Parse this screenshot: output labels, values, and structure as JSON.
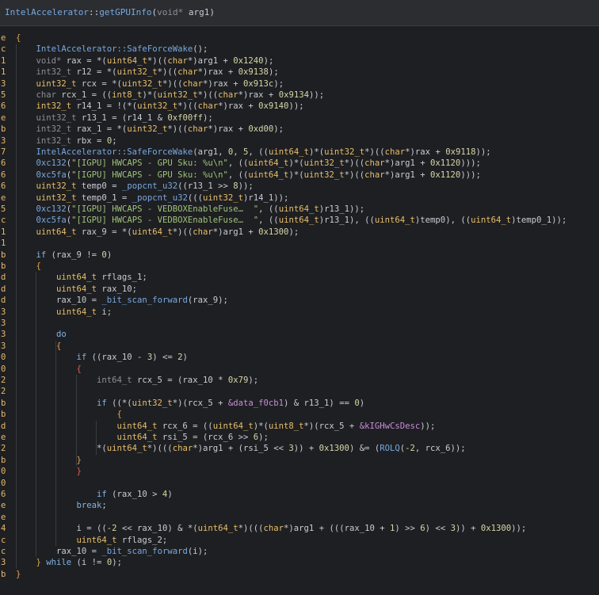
{
  "header": {
    "class_name": "IntelAccelerator",
    "sep": "::",
    "func_name": "getGPUInfo",
    "open": "(",
    "param_type": "void*",
    "param_name": " arg1",
    "close": ")"
  },
  "theme": {
    "background": "#1e1f22",
    "type": "#e8bf6a",
    "keyword": "#7fb4e6",
    "function": "#79a8e0",
    "number": "#d7d7a8",
    "string": "#9ec27a"
  },
  "lines": [
    {
      "g": "e",
      "tokens": [
        [
          "brace",
          "{"
        ]
      ]
    },
    {
      "g": "c",
      "tokens": [
        [
          "fn",
          "IntelAccelerator::SafeForceWake"
        ],
        [
          "pun",
          "();"
        ]
      ]
    },
    {
      "g": "1",
      "tokens": [
        [
          "dim",
          "void* "
        ],
        [
          "plain",
          "rax = *("
        ],
        [
          "type",
          "uint64_t"
        ],
        [
          "plain",
          "*)(("
        ],
        [
          "type",
          "char"
        ],
        [
          "plain",
          "*)arg1 + "
        ],
        [
          "num",
          "0x1240"
        ],
        [
          "plain",
          ");"
        ]
      ]
    },
    {
      "g": "1",
      "tokens": [
        [
          "dim",
          "int32_t "
        ],
        [
          "plain",
          "r12 = *("
        ],
        [
          "type",
          "uint32_t"
        ],
        [
          "plain",
          "*)(("
        ],
        [
          "type",
          "char"
        ],
        [
          "plain",
          "*)rax + "
        ],
        [
          "num",
          "0x9138"
        ],
        [
          "plain",
          ");"
        ]
      ]
    },
    {
      "g": "3",
      "tokens": [
        [
          "type",
          "uint32_t "
        ],
        [
          "plain",
          "rcx = *("
        ],
        [
          "type",
          "uint32_t"
        ],
        [
          "plain",
          "*)(("
        ],
        [
          "type",
          "char"
        ],
        [
          "plain",
          "*)rax + "
        ],
        [
          "num",
          "0x913c"
        ],
        [
          "plain",
          ");"
        ]
      ]
    },
    {
      "g": "5",
      "tokens": [
        [
          "dim",
          "char "
        ],
        [
          "plain",
          "rcx_1 = (("
        ],
        [
          "type",
          "int8_t"
        ],
        [
          "plain",
          ")*("
        ],
        [
          "type",
          "uint32_t"
        ],
        [
          "plain",
          "*)(("
        ],
        [
          "type",
          "char"
        ],
        [
          "plain",
          "*)rax + "
        ],
        [
          "num",
          "0x9134"
        ],
        [
          "plain",
          "));"
        ]
      ]
    },
    {
      "g": "6",
      "tokens": [
        [
          "type",
          "int32_t "
        ],
        [
          "plain",
          "r14_1 = !(*("
        ],
        [
          "type",
          "uint32_t"
        ],
        [
          "plain",
          "*)(("
        ],
        [
          "type",
          "char"
        ],
        [
          "plain",
          "*)rax + "
        ],
        [
          "num",
          "0x9140"
        ],
        [
          "plain",
          "));"
        ]
      ]
    },
    {
      "g": "e",
      "tokens": [
        [
          "dim",
          "uint32_t "
        ],
        [
          "plain",
          "r13_1 = (r14_1 & "
        ],
        [
          "num",
          "0xf00ff"
        ],
        [
          "plain",
          ");"
        ]
      ]
    },
    {
      "g": "b",
      "tokens": [
        [
          "dim",
          "int32_t "
        ],
        [
          "plain",
          "rax_1 = *("
        ],
        [
          "type",
          "uint32_t"
        ],
        [
          "plain",
          "*)(("
        ],
        [
          "type",
          "char"
        ],
        [
          "plain",
          "*)rax + "
        ],
        [
          "num",
          "0xd00"
        ],
        [
          "plain",
          ");"
        ]
      ]
    },
    {
      "g": "3",
      "tokens": [
        [
          "dim",
          "int32_t "
        ],
        [
          "plain",
          "rbx = "
        ],
        [
          "num",
          "0"
        ],
        [
          "plain",
          ";"
        ]
      ]
    },
    {
      "g": "7",
      "tokens": [
        [
          "fn",
          "IntelAccelerator::SafeForceWake"
        ],
        [
          "plain",
          "(arg1, "
        ],
        [
          "num",
          "0"
        ],
        [
          "plain",
          ", "
        ],
        [
          "num",
          "5"
        ],
        [
          "plain",
          ", (("
        ],
        [
          "type",
          "uint64_t"
        ],
        [
          "plain",
          ")*("
        ],
        [
          "type",
          "uint32_t"
        ],
        [
          "plain",
          "*)(("
        ],
        [
          "type",
          "char"
        ],
        [
          "plain",
          "*)rax + "
        ],
        [
          "num",
          "0x9118"
        ],
        [
          "plain",
          "));"
        ]
      ]
    },
    {
      "g": "6",
      "tokens": [
        [
          "fn",
          "0xc132"
        ],
        [
          "plain",
          "("
        ],
        [
          "str",
          "\"[IGPU] HWCAPS - GPU Sku: %u\\n\""
        ],
        [
          "plain",
          ", (("
        ],
        [
          "type",
          "uint64_t"
        ],
        [
          "plain",
          ")*("
        ],
        [
          "type",
          "uint32_t"
        ],
        [
          "plain",
          "*)(("
        ],
        [
          "type",
          "char"
        ],
        [
          "plain",
          "*)arg1 + "
        ],
        [
          "num",
          "0x1120"
        ],
        [
          "plain",
          ")));"
        ]
      ]
    },
    {
      "g": "6",
      "tokens": [
        [
          "fn",
          "0xc5fa"
        ],
        [
          "plain",
          "("
        ],
        [
          "str",
          "\"[IGPU] HWCAPS - GPU Sku: %u\\n\""
        ],
        [
          "plain",
          ", (("
        ],
        [
          "type",
          "uint64_t"
        ],
        [
          "plain",
          ")*("
        ],
        [
          "type",
          "uint32_t"
        ],
        [
          "plain",
          "*)(("
        ],
        [
          "type",
          "char"
        ],
        [
          "plain",
          "*)arg1 + "
        ],
        [
          "num",
          "0x1120"
        ],
        [
          "plain",
          ")));"
        ]
      ]
    },
    {
      "g": "6",
      "tokens": [
        [
          "type",
          "uint32_t "
        ],
        [
          "plain",
          "temp0 = "
        ],
        [
          "fn",
          "_popcnt_u32"
        ],
        [
          "plain",
          "((r13_1 >> "
        ],
        [
          "num",
          "8"
        ],
        [
          "plain",
          "));"
        ]
      ]
    },
    {
      "g": "e",
      "tokens": [
        [
          "type",
          "uint32_t "
        ],
        [
          "plain",
          "temp0_1 = "
        ],
        [
          "fn",
          "_popcnt_u32"
        ],
        [
          "plain",
          "((("
        ],
        [
          "type",
          "uint32_t"
        ],
        [
          "plain",
          ")r14_1));"
        ]
      ]
    },
    {
      "g": "5",
      "tokens": [
        [
          "fn",
          "0xc132"
        ],
        [
          "plain",
          "("
        ],
        [
          "str",
          "\"[IGPU] HWCAPS - VEDBOXEnableFuse…  \""
        ],
        [
          "plain",
          ", (("
        ],
        [
          "type",
          "uint64_t"
        ],
        [
          "plain",
          ")r13_1));"
        ]
      ]
    },
    {
      "g": "c",
      "tokens": [
        [
          "fn",
          "0xc5fa"
        ],
        [
          "plain",
          "("
        ],
        [
          "str",
          "\"[IGPU] HWCAPS - VEDBOXEnableFuse…  \""
        ],
        [
          "plain",
          ", (("
        ],
        [
          "type",
          "uint64_t"
        ],
        [
          "plain",
          ")r13_1), (("
        ],
        [
          "type",
          "uint64_t"
        ],
        [
          "plain",
          ")temp0), (("
        ],
        [
          "type",
          "uint64_t"
        ],
        [
          "plain",
          ")temp0_1));"
        ]
      ]
    },
    {
      "g": "1",
      "tokens": [
        [
          "type",
          "uint64_t "
        ],
        [
          "plain",
          "rax_9 = *("
        ],
        [
          "type",
          "uint64_t"
        ],
        [
          "plain",
          "*)(("
        ],
        [
          "type",
          "char"
        ],
        [
          "plain",
          "*)arg1 + "
        ],
        [
          "num",
          "0x1300"
        ],
        [
          "plain",
          ");"
        ]
      ]
    },
    {
      "g": "1",
      "tokens": []
    },
    {
      "g": "b",
      "tokens": [
        [
          "kw",
          "if "
        ],
        [
          "plain",
          "(rax_9 != "
        ],
        [
          "num",
          "0"
        ],
        [
          "plain",
          ")"
        ]
      ]
    },
    {
      "g": "b",
      "tokens": [
        [
          "brace",
          "{"
        ]
      ]
    },
    {
      "g": "d",
      "tokens": [
        [
          "type",
          "uint64_t "
        ],
        [
          "plain",
          "rflags_1;"
        ]
      ]
    },
    {
      "g": "d",
      "tokens": [
        [
          "type",
          "uint64_t "
        ],
        [
          "plain",
          "rax_10;"
        ]
      ]
    },
    {
      "g": "d",
      "tokens": [
        [
          "plain",
          "rax_10 = "
        ],
        [
          "fn",
          "_bit_scan_forward"
        ],
        [
          "plain",
          "(rax_9);"
        ]
      ]
    },
    {
      "g": "3",
      "tokens": [
        [
          "type",
          "uint64_t "
        ],
        [
          "plain",
          "i;"
        ]
      ]
    },
    {
      "g": "3",
      "tokens": []
    },
    {
      "g": "3",
      "tokens": [
        [
          "kw",
          "do"
        ]
      ]
    },
    {
      "g": "3",
      "tokens": [
        [
          "brace",
          "{"
        ]
      ]
    },
    {
      "g": "0",
      "tokens": [
        [
          "kw",
          "if "
        ],
        [
          "plain",
          "((rax_10 - "
        ],
        [
          "num",
          "3"
        ],
        [
          "plain",
          ") <= "
        ],
        [
          "num",
          "2"
        ],
        [
          "plain",
          ")"
        ]
      ]
    },
    {
      "g": "0",
      "tokens": [
        [
          "red",
          "{"
        ]
      ]
    },
    {
      "g": "2",
      "tokens": [
        [
          "dim",
          "int64_t "
        ],
        [
          "plain",
          "rcx_5 = (rax_10 * "
        ],
        [
          "num",
          "0x79"
        ],
        [
          "plain",
          ");"
        ]
      ]
    },
    {
      "g": "2",
      "tokens": []
    },
    {
      "g": "b",
      "tokens": [
        [
          "kw",
          "if "
        ],
        [
          "plain",
          "((*("
        ],
        [
          "type",
          "uint32_t"
        ],
        [
          "plain",
          "*)(rcx_5 + "
        ],
        [
          "data",
          "&data_f0cb1"
        ],
        [
          "plain",
          ") & r13_1) == "
        ],
        [
          "num",
          "0"
        ],
        [
          "plain",
          ")"
        ]
      ]
    },
    {
      "g": "b",
      "tokens": [
        [
          "brace",
          "{"
        ]
      ]
    },
    {
      "g": "d",
      "tokens": [
        [
          "type",
          "uint64_t "
        ],
        [
          "plain",
          "rcx_6 = (("
        ],
        [
          "type",
          "uint64_t"
        ],
        [
          "plain",
          ")*("
        ],
        [
          "type",
          "uint8_t"
        ],
        [
          "plain",
          "*)(rcx_5 + "
        ],
        [
          "data",
          "&kIGHwCsDesc"
        ],
        [
          "plain",
          "));"
        ]
      ]
    },
    {
      "g": "e",
      "tokens": [
        [
          "type",
          "uint64_t "
        ],
        [
          "plain",
          "rsi_5 = (rcx_6 >> "
        ],
        [
          "num",
          "6"
        ],
        [
          "plain",
          ");"
        ]
      ]
    },
    {
      "g": "2",
      "tokens": [
        [
          "plain",
          "*("
        ],
        [
          "type",
          "uint64_t"
        ],
        [
          "plain",
          "*)((("
        ],
        [
          "type",
          "char"
        ],
        [
          "plain",
          "*)arg1 + (rsi_5 << "
        ],
        [
          "num",
          "3"
        ],
        [
          "plain",
          ")) + "
        ],
        [
          "num",
          "0x1300"
        ],
        [
          "plain",
          ") &= ("
        ],
        [
          "fn",
          "ROLQ"
        ],
        [
          "plain",
          "("
        ],
        [
          "num",
          "-2"
        ],
        [
          "plain",
          ", rcx_6));"
        ]
      ]
    },
    {
      "g": "b",
      "tokens": [
        [
          "brace",
          "}"
        ]
      ]
    },
    {
      "g": "0",
      "tokens": [
        [
          "red",
          "}"
        ]
      ]
    },
    {
      "g": "0",
      "tokens": []
    },
    {
      "g": "6",
      "tokens": [
        [
          "kw",
          "if "
        ],
        [
          "plain",
          "(rax_10 > "
        ],
        [
          "num",
          "4"
        ],
        [
          "plain",
          ")"
        ]
      ]
    },
    {
      "g": "e",
      "tokens": [
        [
          "kw",
          "break"
        ],
        [
          "plain",
          ";"
        ]
      ]
    },
    {
      "g": "e",
      "tokens": []
    },
    {
      "g": "4",
      "tokens": [
        [
          "plain",
          "i = (("
        ],
        [
          "num",
          "-2"
        ],
        [
          "plain",
          " << rax_10) & *("
        ],
        [
          "type",
          "uint64_t"
        ],
        [
          "plain",
          "*)((("
        ],
        [
          "type",
          "char"
        ],
        [
          "plain",
          "*)arg1 + ((("
        ],
        [
          "plain",
          "rax_10 + "
        ],
        [
          "num",
          "1"
        ],
        [
          "plain",
          ") >> "
        ],
        [
          "num",
          "6"
        ],
        [
          "plain",
          ") << "
        ],
        [
          "num",
          "3"
        ],
        [
          "plain",
          ")) + "
        ],
        [
          "num",
          "0x1300"
        ],
        [
          "plain",
          "));"
        ]
      ]
    },
    {
      "g": "c",
      "tokens": [
        [
          "type",
          "uint64_t "
        ],
        [
          "plain",
          "rflags_2;"
        ]
      ]
    },
    {
      "g": "c",
      "tokens": [
        [
          "plain",
          "rax_10 = "
        ],
        [
          "fn",
          "_bit_scan_forward"
        ],
        [
          "plain",
          "(i);"
        ]
      ]
    },
    {
      "g": "3",
      "tokens": [
        [
          "brace",
          "} "
        ],
        [
          "kw",
          "while "
        ],
        [
          "plain",
          "(i != "
        ],
        [
          "num",
          "0"
        ],
        [
          "plain",
          ");"
        ]
      ]
    },
    {
      "g": "b",
      "tokens": [
        [
          "brace",
          "}"
        ]
      ]
    }
  ]
}
